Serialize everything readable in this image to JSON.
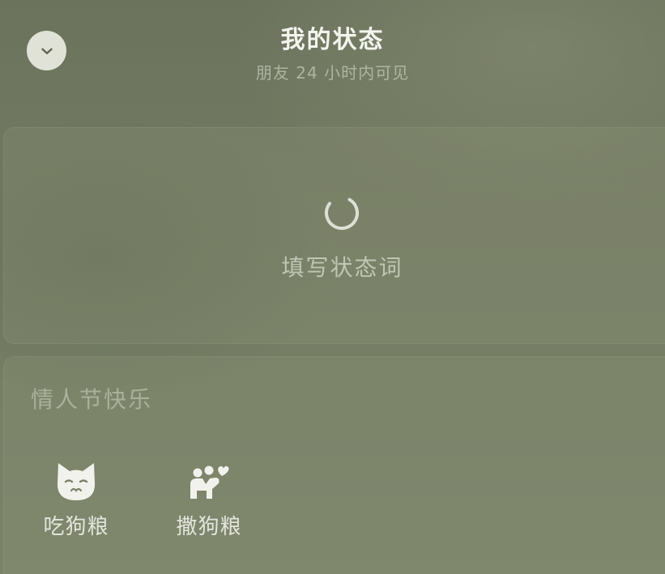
{
  "header": {
    "title": "我的状态",
    "subtitle": "朋友 24 小时内可见",
    "collapse_icon": "chevron-down-icon"
  },
  "status_input": {
    "loading": true,
    "placeholder": "填写状态词"
  },
  "presets": {
    "section_title": "情人节快乐",
    "items": [
      {
        "label": "吃狗粮",
        "icon": "cat-face-icon"
      },
      {
        "label": "撒狗粮",
        "icon": "hug-heart-icon"
      }
    ]
  },
  "colors": {
    "icon_fill": "#f2f2ec",
    "text_primary": "#f3f4ee",
    "background": "#737b63"
  }
}
